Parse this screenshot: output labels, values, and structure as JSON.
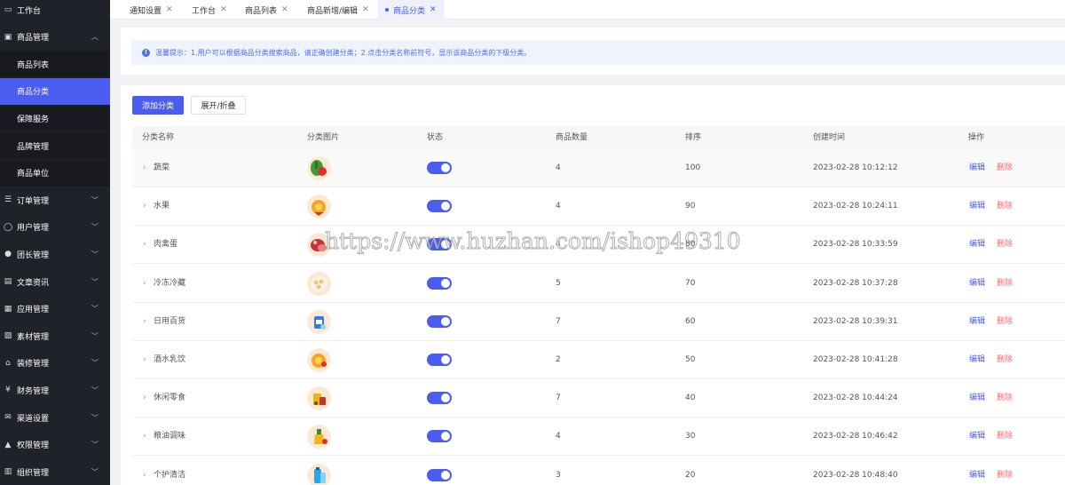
{
  "sidebar": {
    "items": [
      {
        "key": "workbench",
        "label": "工作台",
        "icon": "monitor-icon",
        "top": 0,
        "type": "top"
      },
      {
        "key": "goods",
        "label": "商品管理",
        "icon": "shopping-bag-icon",
        "type": "group-open"
      },
      {
        "key": "goods-list",
        "label": "商品列表",
        "type": "sub"
      },
      {
        "key": "goods-category",
        "label": "商品分类",
        "type": "sub-active"
      },
      {
        "key": "guarantee",
        "label": "保障服务",
        "type": "sub"
      },
      {
        "key": "brand",
        "label": "品牌管理",
        "type": "sub"
      },
      {
        "key": "unit",
        "label": "商品单位",
        "type": "sub"
      },
      {
        "key": "orders",
        "label": "订单管理",
        "icon": "list-icon",
        "type": "group"
      },
      {
        "key": "users",
        "label": "用户管理",
        "icon": "user-icon",
        "type": "group"
      },
      {
        "key": "leaders",
        "label": "团长管理",
        "icon": "person-filled-icon",
        "type": "group"
      },
      {
        "key": "articles",
        "label": "文章资讯",
        "icon": "message-icon",
        "type": "group"
      },
      {
        "key": "apps",
        "label": "应用管理",
        "icon": "grid-icon",
        "type": "group"
      },
      {
        "key": "materials",
        "label": "素材管理",
        "icon": "picture-icon",
        "type": "group"
      },
      {
        "key": "decoration",
        "label": "装修管理",
        "icon": "shop-icon",
        "type": "group"
      },
      {
        "key": "finance",
        "label": "财务管理",
        "icon": "money-icon",
        "type": "group"
      },
      {
        "key": "channels",
        "label": "渠道设置",
        "icon": "mail-icon",
        "type": "group"
      },
      {
        "key": "permissions",
        "label": "权限管理",
        "icon": "lock-icon",
        "type": "group"
      },
      {
        "key": "organization",
        "label": "组织管理",
        "icon": "building-icon",
        "type": "group"
      }
    ]
  },
  "tabs": [
    {
      "label": "通知设置",
      "active": false
    },
    {
      "label": "工作台",
      "active": false
    },
    {
      "label": "商品列表",
      "active": false
    },
    {
      "label": "商品新增/编辑",
      "active": false
    },
    {
      "label": "商品分类",
      "active": true
    }
  ],
  "notice": {
    "text": "温馨提示：1.用户可以根据商品分类搜索商品，请正确创建分类；2.点击分类名称前符号，显示该商品分类的下级分类。"
  },
  "toolbar": {
    "add_label": "添加分类",
    "toggle_label": "展开/折叠"
  },
  "table": {
    "columns": [
      "分类名称",
      "分类图片",
      "状态",
      "商品数量",
      "排序",
      "创建时间",
      "操作"
    ],
    "edit_label": "编辑",
    "delete_label": "删除",
    "rows": [
      {
        "name": "蔬菜",
        "thumb": "vegetable",
        "status": true,
        "count": "4",
        "sort": "100",
        "created": "2023-02-28 10:12:12"
      },
      {
        "name": "水果",
        "thumb": "fruit",
        "status": true,
        "count": "4",
        "sort": "90",
        "created": "2023-02-28 10:24:11"
      },
      {
        "name": "肉禽蛋",
        "thumb": "meat",
        "status": true,
        "count": "4",
        "sort": "80",
        "created": "2023-02-28 10:33:59"
      },
      {
        "name": "冷冻冷藏",
        "thumb": "frozen",
        "status": true,
        "count": "5",
        "sort": "70",
        "created": "2023-02-28 10:37:28"
      },
      {
        "name": "日用百货",
        "thumb": "daily",
        "status": true,
        "count": "7",
        "sort": "60",
        "created": "2023-02-28 10:39:31"
      },
      {
        "name": "酒水乳饮",
        "thumb": "drinks",
        "status": true,
        "count": "2",
        "sort": "50",
        "created": "2023-02-28 10:41:28"
      },
      {
        "name": "休闲零食",
        "thumb": "snacks",
        "status": true,
        "count": "7",
        "sort": "40",
        "created": "2023-02-28 10:44:24"
      },
      {
        "name": "粮油调味",
        "thumb": "grain-oil",
        "status": true,
        "count": "4",
        "sort": "30",
        "created": "2023-02-28 10:46:42"
      },
      {
        "name": "个护清洁",
        "thumb": "care",
        "status": true,
        "count": "3",
        "sort": "20",
        "created": "2023-02-28 10:48:40"
      }
    ]
  },
  "watermark": "https://www.huzhan.com/ishop49310",
  "colors": {
    "accent": "#4b5cf0",
    "sidebar_bg": "#20222a",
    "delete": "#f56c6c"
  }
}
